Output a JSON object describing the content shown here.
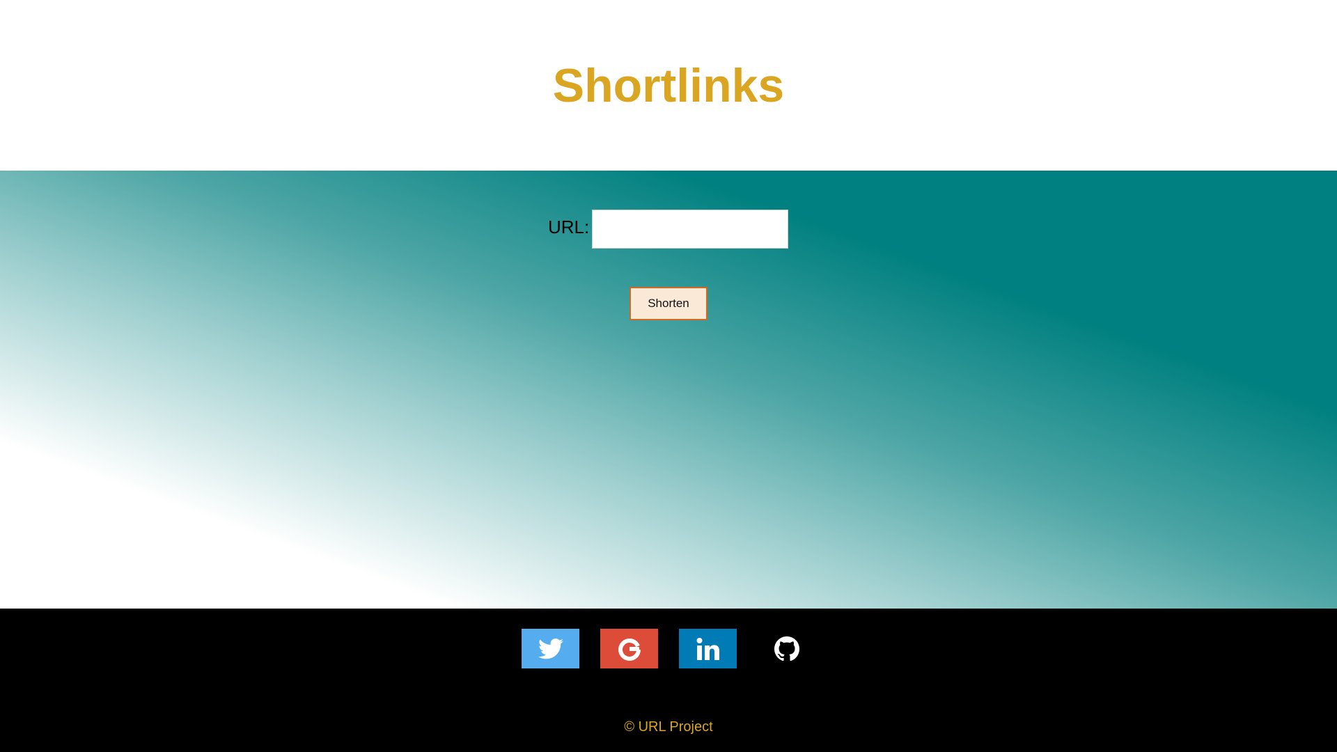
{
  "header": {
    "title": "Shortlinks"
  },
  "form": {
    "url_label": "URL:",
    "url_value": "",
    "url_placeholder": "",
    "shorten_label": "Shorten"
  },
  "footer": {
    "social": [
      {
        "name": "twitter",
        "icon": "twitter-icon",
        "color": "#55acee"
      },
      {
        "name": "google",
        "icon": "google-icon",
        "color": "#dd4b39"
      },
      {
        "name": "linkedin",
        "icon": "linkedin-icon",
        "color": "#007bb5"
      },
      {
        "name": "github",
        "icon": "github-icon",
        "color": "#000000"
      }
    ],
    "copyright": "© URL Project"
  },
  "colors": {
    "title": "#daa520",
    "main_gradient_start": "#008080",
    "main_gradient_end": "#ffffff",
    "button_bg": "#fbe9d7",
    "button_border": "#d2691e",
    "footer_bg": "#000000",
    "copyright": "#daa520"
  }
}
